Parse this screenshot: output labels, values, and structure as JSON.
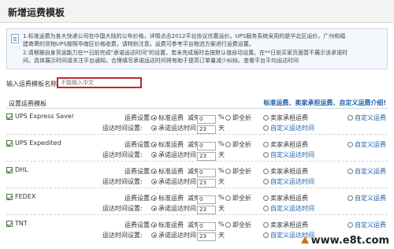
{
  "page_title": "新增运费模板",
  "notice": {
    "lines": [
      "1.标准运费为各大快递公司在中国大陆的公布价格，详情点击2012平台协议优惠运价。UPS服务系统采用的是华北区运价，广州和福",
      "建商寄的货物UPS按照华南区价格收费，请特别注意。运费可参考平台物流方案进行运费设置。",
      "2.请根据自身货运能力在**日前完成\"承诺运达时间\"的设置，若未完成届时会按默认值自动设置。在**日前买家页面暂不展示该承诺时",
      "间，具体展示时间请关注平台通知。合理填写承诺运达时间将有助于提高订单量减少纠纷。查看平台平均运达时间"
    ]
  },
  "name_field": {
    "label": "输入运费模板名称:",
    "placeholder": "不能输入中文"
  },
  "section": {
    "label": "设置运费模板",
    "help_link": "标准运费、卖家承担运费、自定义运费介绍!"
  },
  "common": {
    "fee_label": "运费设置:",
    "standard": "标准运费",
    "discount": "减免",
    "discount_value": "0",
    "percent": "%",
    "free": "即全折",
    "seller": "卖家承担运费",
    "custom_fee": "自定义运费",
    "time_label": "运达时间设置:",
    "promise": "承诺运达时间",
    "days": "23",
    "day_unit": "天",
    "custom_time": "自定义运达时间"
  },
  "carriers": [
    {
      "name": "UPS Express Saver",
      "checked": true
    },
    {
      "name": "UPS Expedited",
      "checked": true
    },
    {
      "name": "DHL",
      "checked": true
    },
    {
      "name": "FEDEX",
      "checked": true
    },
    {
      "name": "TNT",
      "checked": true
    }
  ],
  "watermark": "www.e8t.com"
}
